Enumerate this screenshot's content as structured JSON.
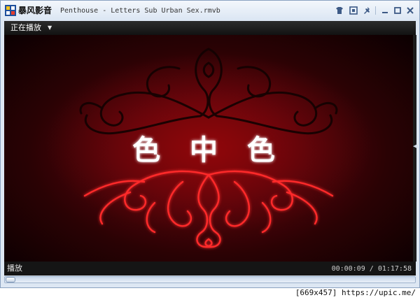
{
  "app": {
    "name": "暴风影音",
    "file_title": "Penthouse - Letters Sub Urban Sex.rmvb",
    "logo_icon": "storm-player-logo-icon"
  },
  "titlebar": {
    "buttons": [
      "skin-icon",
      "mini-mode-icon",
      "pin-icon",
      "minimize-icon",
      "maximize-icon",
      "close-icon"
    ]
  },
  "now_playing": {
    "label": "正在播放",
    "dropdown_icon": "triangle-down-icon"
  },
  "video": {
    "title_text": "色 中 色",
    "colors": {
      "top_ornament": "#140303",
      "bottom_ornament": "#ff2424",
      "background": "#56040a",
      "text": "#ffffff"
    }
  },
  "status": {
    "state": "播放",
    "time_current": "00:00:09",
    "time_separator": "/",
    "time_total": "01:17:58"
  },
  "seek": {
    "progress": 0.002
  },
  "watermark": "[669x457] https://upic.me/"
}
